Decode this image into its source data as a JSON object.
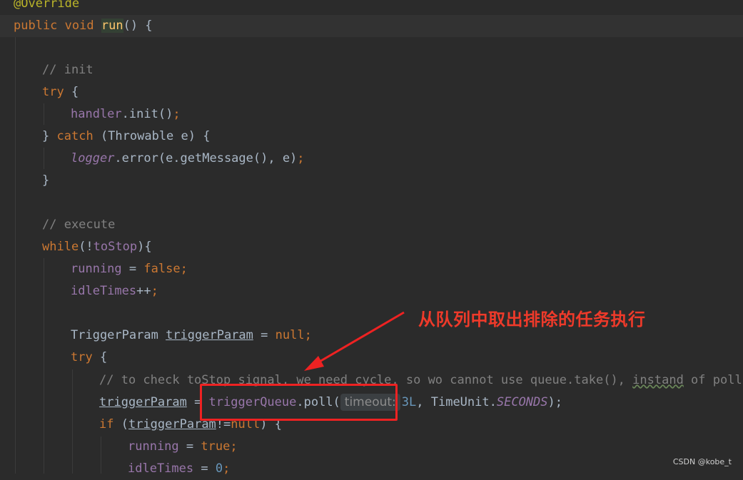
{
  "editor": {
    "line_annotation": "@Override",
    "line_run": [
      "public",
      "void",
      "run",
      "() {"
    ],
    "comment_init": "// init",
    "try1": "try",
    "brace_open": "{",
    "handler": "handler",
    "init_call": ".init()",
    "catch_close": "}",
    "catch_kw": "catch",
    "catch_rest": "(Throwable e) {",
    "logger": "logger",
    "logger_call": ".error(e.getMessage(), e)",
    "brace_close": "}",
    "comment_execute": "// execute",
    "while_kw": "while",
    "while_rest_a": "(!",
    "toStop": "toStop",
    "while_rest_b": "){",
    "running": "running",
    "assign": " = ",
    "false_kw": "false",
    "idleTimes": "idleTimes",
    "plusplus": "++",
    "trigger_type": "TriggerParam ",
    "triggerParam": "triggerParam",
    "null_kw": "null",
    "try2": "try",
    "long_comment_a": "// to check toStop signal, we need cycle, so wo cannot use queue.take(), ",
    "long_comment_instand": "instand",
    "long_comment_b": " of poll(t",
    "triggerQueue": "triggerQueue",
    "poll_call": ".poll(",
    "param_hint": "timeout:",
    "poll_num": "3L",
    "timeunit": ", TimeUnit.",
    "seconds": "SECONDS",
    "poll_end": ");",
    "if_kw": "if",
    "if_open": " (",
    "neq": "!=",
    "if_close": ") {",
    "true_kw": "true",
    "idle_reset_num": "0",
    "semi": ";",
    "space": " "
  },
  "annotation": {
    "callout": "从队列中取出排除的任务执行",
    "box_color": "#ee2222"
  },
  "watermark": "CSDN @kobe_t"
}
